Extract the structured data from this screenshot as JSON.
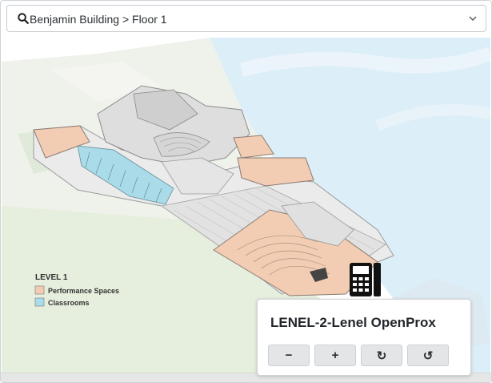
{
  "location_selector": {
    "path_text": "Benjamin Building > Floor 1",
    "search_icon": "search-icon",
    "dropdown_icon": "chevron-down-icon"
  },
  "floor_map": {
    "legend": {
      "title": "LEVEL 1",
      "items": [
        {
          "label": "Performance Spaces",
          "color": "#f2cdb4"
        },
        {
          "label": "Classrooms",
          "color": "#a9dbe8"
        }
      ]
    },
    "device_marker_icon": "access-panel-icon"
  },
  "device_popup": {
    "title": "LENEL-2-Lenel OpenProx",
    "buttons": [
      {
        "name": "zoom-out-button",
        "symbol": "−"
      },
      {
        "name": "zoom-in-button",
        "symbol": "+"
      },
      {
        "name": "rotate-clockwise-button",
        "symbol": "↻"
      },
      {
        "name": "rotate-counterclockwise-button",
        "symbol": "↺"
      }
    ]
  },
  "colors": {
    "water": "#dceef7",
    "grass": "#e8efe0",
    "performance": "#f2cdb4",
    "classroom": "#a9dbe8",
    "building": "#e9e9e9"
  }
}
